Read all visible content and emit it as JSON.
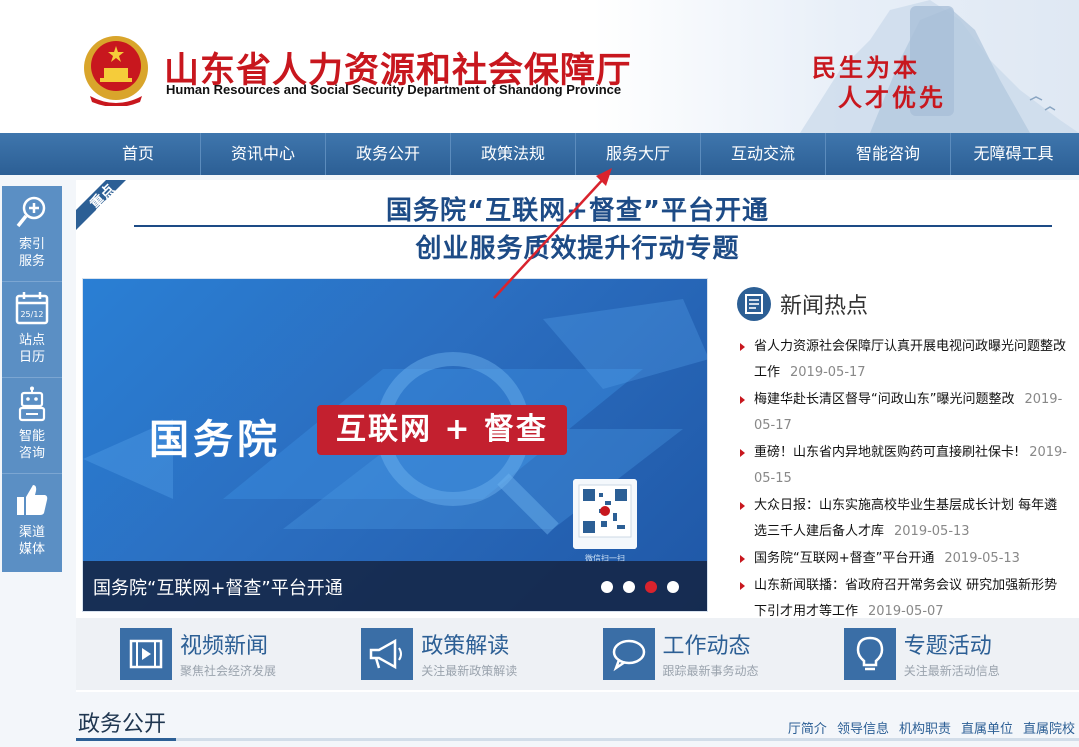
{
  "header": {
    "title": "山东省人力资源和社会保障厅",
    "subtitle": "Human Resources and Social Security Department of Shandong Province",
    "slogan_line1": "民生为本",
    "slogan_line2": "人才优先"
  },
  "nav": {
    "items": [
      "首页",
      "资讯中心",
      "政务公开",
      "政策法规",
      "服务大厅",
      "互动交流",
      "智能咨询",
      "无障碍工具"
    ]
  },
  "sidebar": {
    "items": [
      {
        "label": "索引服务",
        "icon": "search-plus-icon"
      },
      {
        "label": "站点日历",
        "icon": "calendar-icon",
        "badge": "25/12"
      },
      {
        "label": "智能咨询",
        "icon": "robot-icon"
      },
      {
        "label": "渠道媒体",
        "icon": "thumbs-up-icon"
      }
    ]
  },
  "highlight": {
    "ribbon": "重点",
    "line1": "国务院“互联网+督查”平台开通",
    "line2": "创业服务质效提升行动专题"
  },
  "carousel": {
    "main_text": "国务院",
    "tag_text": "互联网 + 督查",
    "qr_caption": "微信扫一扫",
    "caption": "国务院“互联网+督查”平台开通",
    "active_index": 2,
    "slide_count": 4
  },
  "news": {
    "title": "新闻热点",
    "items": [
      {
        "text": "省人力资源社会保障厅认真开展电视问政曝光问题整改工作",
        "date": "2019-05-17"
      },
      {
        "text": "梅建华赴长清区督导“问政山东”曝光问题整改",
        "date": "2019-05-17"
      },
      {
        "text": "重磅！山东省内异地就医购药可直接刷社保卡!",
        "date": "2019-05-15"
      },
      {
        "text": "大众日报：山东实施高校毕业生基层成长计划 每年遴选三千人建后备人才库",
        "date": "2019-05-13"
      },
      {
        "text": "国务院“互联网+督查”平台开通",
        "date": "2019-05-13"
      },
      {
        "text": "山东新闻联播：省政府召开常务会议 研究加强新形势下引才用才等工作",
        "date": "2019-05-07"
      }
    ]
  },
  "features": [
    {
      "title": "视频新闻",
      "desc": "聚焦社会经济发展",
      "icon": "video-icon"
    },
    {
      "title": "政策解读",
      "desc": "关注最新政策解读",
      "icon": "megaphone-icon"
    },
    {
      "title": "工作动态",
      "desc": "跟踪最新事务动态",
      "icon": "chat-bubble-icon"
    },
    {
      "title": "专题活动",
      "desc": "关注最新活动信息",
      "icon": "lightbulb-icon"
    }
  ],
  "section": {
    "title": "政务公开",
    "links": [
      "厅简介",
      "领导信息",
      "机构职责",
      "直属单位",
      "直属院校"
    ]
  },
  "colors": {
    "brand_red": "#c8171e",
    "nav_blue": "#2c5f95",
    "sidebar_blue": "#5b8fc4"
  }
}
